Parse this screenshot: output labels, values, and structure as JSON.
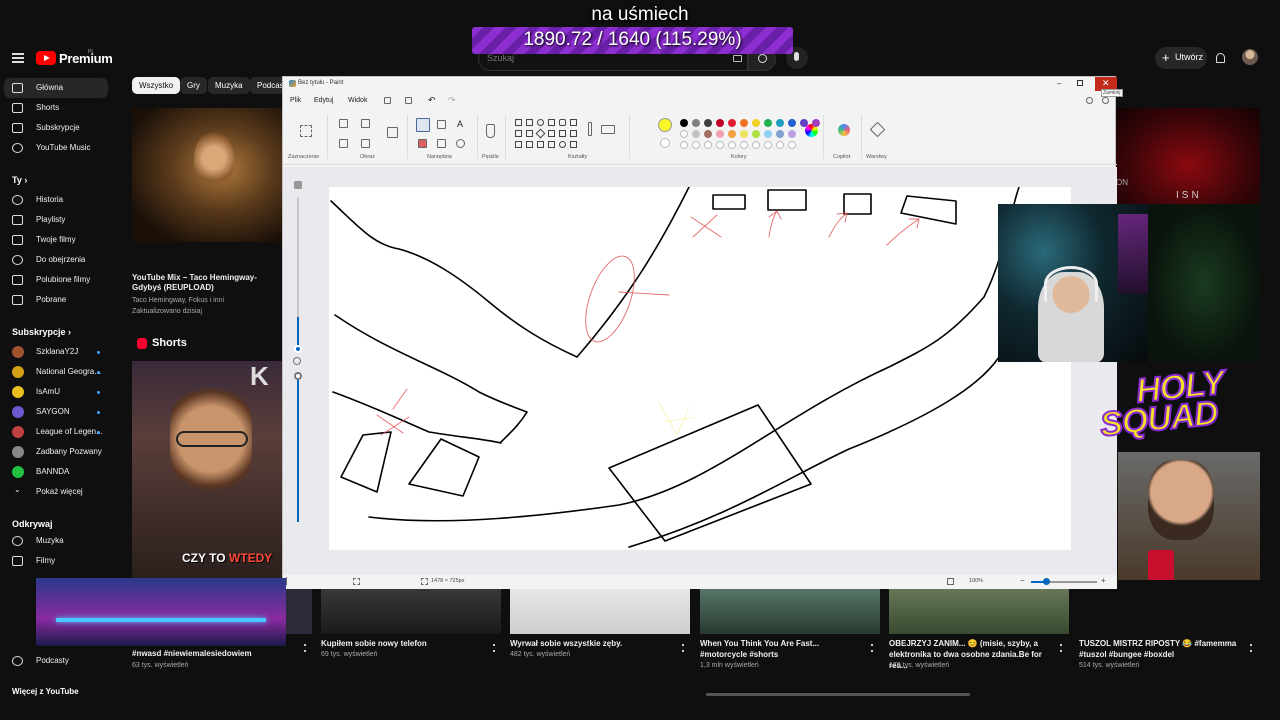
{
  "overlay": {
    "title": "na uśmiech",
    "goal": "1890.72 / 1640 (115.29%)",
    "goal_progress": 1.0,
    "brand_text_1": "HOLY",
    "brand_text_2": "SQUAD"
  },
  "youtube": {
    "logo_text": "Premium",
    "logo_region": "PL",
    "search_placeholder": "Szukaj",
    "create_label": "Utwórz",
    "sidebar": {
      "main": [
        {
          "label": "Główna",
          "icon": "home-icon",
          "active": true
        },
        {
          "label": "Shorts",
          "icon": "shorts-icon"
        },
        {
          "label": "Subskrypcje",
          "icon": "subscriptions-icon"
        },
        {
          "label": "YouTube Music",
          "icon": "music-icon"
        }
      ],
      "you_header": "Ty",
      "you": [
        {
          "label": "Historia",
          "icon": "history-icon"
        },
        {
          "label": "Playlisty",
          "icon": "playlist-icon"
        },
        {
          "label": "Twoje filmy",
          "icon": "video-icon"
        },
        {
          "label": "Do obejrzenia",
          "icon": "clock-icon"
        },
        {
          "label": "Polubione filmy",
          "icon": "like-icon"
        },
        {
          "label": "Pobrane",
          "icon": "download-icon"
        }
      ],
      "subs_header": "Subskrypcje",
      "subs": [
        {
          "label": "SzklanaY2J",
          "color": "#a0522d"
        },
        {
          "label": "National Geogra...",
          "color": "#d4a017"
        },
        {
          "label": "IsAmU",
          "color": "#e8c020"
        },
        {
          "label": "SAYGON",
          "color": "#6a5acd"
        },
        {
          "label": "League of Legen...",
          "color": "#c04040"
        },
        {
          "label": "Zadbany Pozwany",
          "color": "#888888"
        },
        {
          "label": "BANNDA",
          "color": "#20c040"
        }
      ],
      "show_more": "Pokaż więcej",
      "explore_header": "Odkrywaj",
      "explore": [
        {
          "label": "Muzyka",
          "icon": "music-note-icon"
        },
        {
          "label": "Filmy",
          "icon": "film-icon"
        },
        {
          "label": "Podcasty",
          "icon": "podcast-icon"
        }
      ],
      "more_header": "Więcej z YouTube"
    },
    "chips": [
      {
        "label": "Wszystko",
        "active": true
      },
      {
        "label": "Gry"
      },
      {
        "label": "Muzyka"
      },
      {
        "label": "Podcasty"
      }
    ],
    "mix": {
      "title": "YouTube Mix – Taco Hemingway- Gdybyś (REUPLOAD)",
      "channel": "Taco Hemingway, Fokus i inni",
      "updated": "Zaktualizowano dzisiaj"
    },
    "shorts_header": "Shorts",
    "short1_caption": "CZY TO ",
    "short1_caption_accent": "WTEDY",
    "shorts": [
      {
        "title": "#nwasd #niewiemalesiedowiem",
        "views": "63 tys. wyświetleń"
      },
      {
        "title": "Kupiłem sobie nowy telefon",
        "views": "69 tys. wyświetleń"
      },
      {
        "title": "Wyrwał sobie wszystkie zęby.",
        "views": "482 tys. wyświetleń"
      },
      {
        "title": "When You Think You Are Fast... #motorcycle #shorts",
        "views": "1,3 mln wyświetleń"
      },
      {
        "title": "OBEJRZYJ ZANIM... 😊 (misie, szyby, a elektronika to dwa osobne zdania.Be for rea...",
        "views": "170 tys. wyświetleń"
      },
      {
        "title": "TUSZOL MISTRZ RIPOSTY 😂 #famemma #tuszol #bungee #boxdel",
        "views": "514 tys. wyświetleń"
      }
    ]
  },
  "paint": {
    "title": "Bez tytułu - Paint",
    "close_tooltip": "Zamknij",
    "menu": [
      "Plik",
      "Edytuj",
      "Widok"
    ],
    "groups": [
      "Zaznaczenie",
      "Obraz",
      "Narzędzia",
      "Pędzle",
      "Kształty",
      "Kolory",
      "Copilot",
      "Warstwy"
    ],
    "palette": [
      "#000000",
      "#7f7f7f",
      "#404040",
      "#c00020",
      "#e02030",
      "#f07020",
      "#f0d020",
      "#20b050",
      "#20a0c0",
      "#2060d0",
      "#6040c0",
      "#a040c0",
      "#ffffff",
      "#c3c3c3",
      "#a07060",
      "#f0a0b0",
      "#f0a040",
      "#f0e060",
      "#b0e040",
      "#90d0f0",
      "#80a0d0",
      "#c0a0e0"
    ],
    "selected_color": "#f7f72a",
    "canvas_size": "1478 × 725px",
    "zoom": "100%"
  }
}
